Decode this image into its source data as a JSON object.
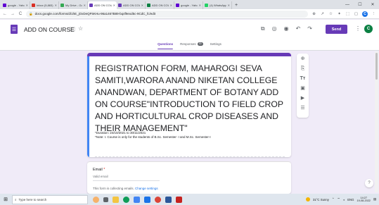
{
  "browser": {
    "tabs": [
      {
        "title": "google - Yahoo",
        "color": "#6001d2",
        "active": false
      },
      {
        "title": "Inbox (5,883) -",
        "color": "#d93025",
        "active": false
      },
      {
        "title": "My Drive - Goo",
        "color": "#34a853",
        "active": false
      },
      {
        "title": "ADD ON COUR",
        "color": "#673ab7",
        "active": true
      },
      {
        "title": "ADD ON COUR",
        "color": "#673ab7",
        "active": false
      },
      {
        "title": "ADD ON COUR",
        "color": "#0b8043",
        "active": false
      },
      {
        "title": "google - Yahoo",
        "color": "#6001d2",
        "active": false
      },
      {
        "title": "(4) WhatsApp",
        "color": "#25d366",
        "active": false
      }
    ],
    "new_tab": "+",
    "url": "docs.google.com/forms/d/1hE_jOxDeQF5KHu-96a1467B89-bq4f9exd5c-9CdC_fc/edit"
  },
  "form_header": {
    "title": "ADD ON COURSE",
    "send_label": "Send",
    "account_initial": "C",
    "tabs": [
      {
        "label": "Questions",
        "active": true,
        "badge": ""
      },
      {
        "label": "Responses",
        "active": false,
        "badge": "30"
      },
      {
        "label": "Settings",
        "active": false,
        "badge": ""
      }
    ]
  },
  "form": {
    "title": "REGISTRATION FORM, MAHAROGI SEVA SAMITI,WARORA  ANAND NIKETAN COLLEGE ANANDWAN, DEPARTMENT OF BOTANY  ADD ON COURSE\"INTRODUCTION TO FIELD CROP AND HORTICULTURAL CROP DISEASES AND THEIR MANAGEMENT\"",
    "description_line1": "*Duration: 24/10/2021 to  30/11/2021",
    "description_line2": "*Note: I. Course is only for the students of B.Sc. Semester- I and M.Sc. Semester-I",
    "email_label": "Email",
    "required_mark": "*",
    "email_placeholder": "Valid email",
    "collect_note": "This form is collecting emails.",
    "change_settings": "Change settings"
  },
  "side_toolbar": [
    "add-question",
    "import-questions",
    "add-title",
    "add-image",
    "add-video",
    "add-section"
  ],
  "taskbar": {
    "search_placeholder": "Type here to search",
    "weather": "31°C  Sunny",
    "lang": "ENG",
    "time": "14:27",
    "date": "19-08-2022"
  }
}
